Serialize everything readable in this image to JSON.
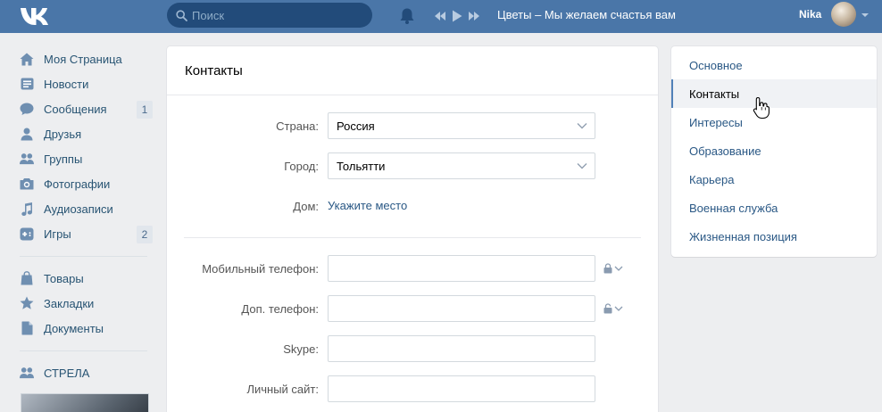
{
  "header": {
    "search_placeholder": "Поиск",
    "track": "Цветы – Мы желаем счастья вам",
    "username": "Nika",
    "accent": "#4a76a8"
  },
  "leftnav": {
    "group1": [
      {
        "label": "Моя Страница",
        "icon": "home-icon"
      },
      {
        "label": "Новости",
        "icon": "news-icon"
      },
      {
        "label": "Сообщения",
        "icon": "messages-icon",
        "count": "1"
      },
      {
        "label": "Друзья",
        "icon": "friends-icon"
      },
      {
        "label": "Группы",
        "icon": "groups-icon"
      },
      {
        "label": "Фотографии",
        "icon": "camera-icon"
      },
      {
        "label": "Аудиозаписи",
        "icon": "music-note-icon"
      },
      {
        "label": "Игры",
        "icon": "gamepad-icon",
        "count": "2"
      }
    ],
    "group2": [
      {
        "label": "Товары",
        "icon": "shopping-bag-icon"
      },
      {
        "label": "Закладки",
        "icon": "star-icon"
      },
      {
        "label": "Документы",
        "icon": "document-icon"
      }
    ],
    "group3": [
      {
        "label": "СТРЕЛА",
        "icon": "group-community-icon"
      }
    ]
  },
  "main": {
    "title": "Контакты",
    "country": {
      "label": "Страна:",
      "value": "Россия"
    },
    "city": {
      "label": "Город:",
      "value": "Тольятти"
    },
    "home": {
      "label": "Дом:",
      "link": "Укажите место"
    },
    "mobile": {
      "label": "Мобильный телефон:",
      "value": ""
    },
    "extra_phone": {
      "label": "Доп. телефон:",
      "value": ""
    },
    "skype": {
      "label": "Skype:",
      "value": ""
    },
    "website": {
      "label": "Личный сайт:",
      "value": ""
    }
  },
  "rightmenu": {
    "items": [
      {
        "label": "Основное"
      },
      {
        "label": "Контакты",
        "active": true
      },
      {
        "label": "Интересы"
      },
      {
        "label": "Образование"
      },
      {
        "label": "Карьера"
      },
      {
        "label": "Военная служба"
      },
      {
        "label": "Жизненная позиция"
      }
    ]
  }
}
